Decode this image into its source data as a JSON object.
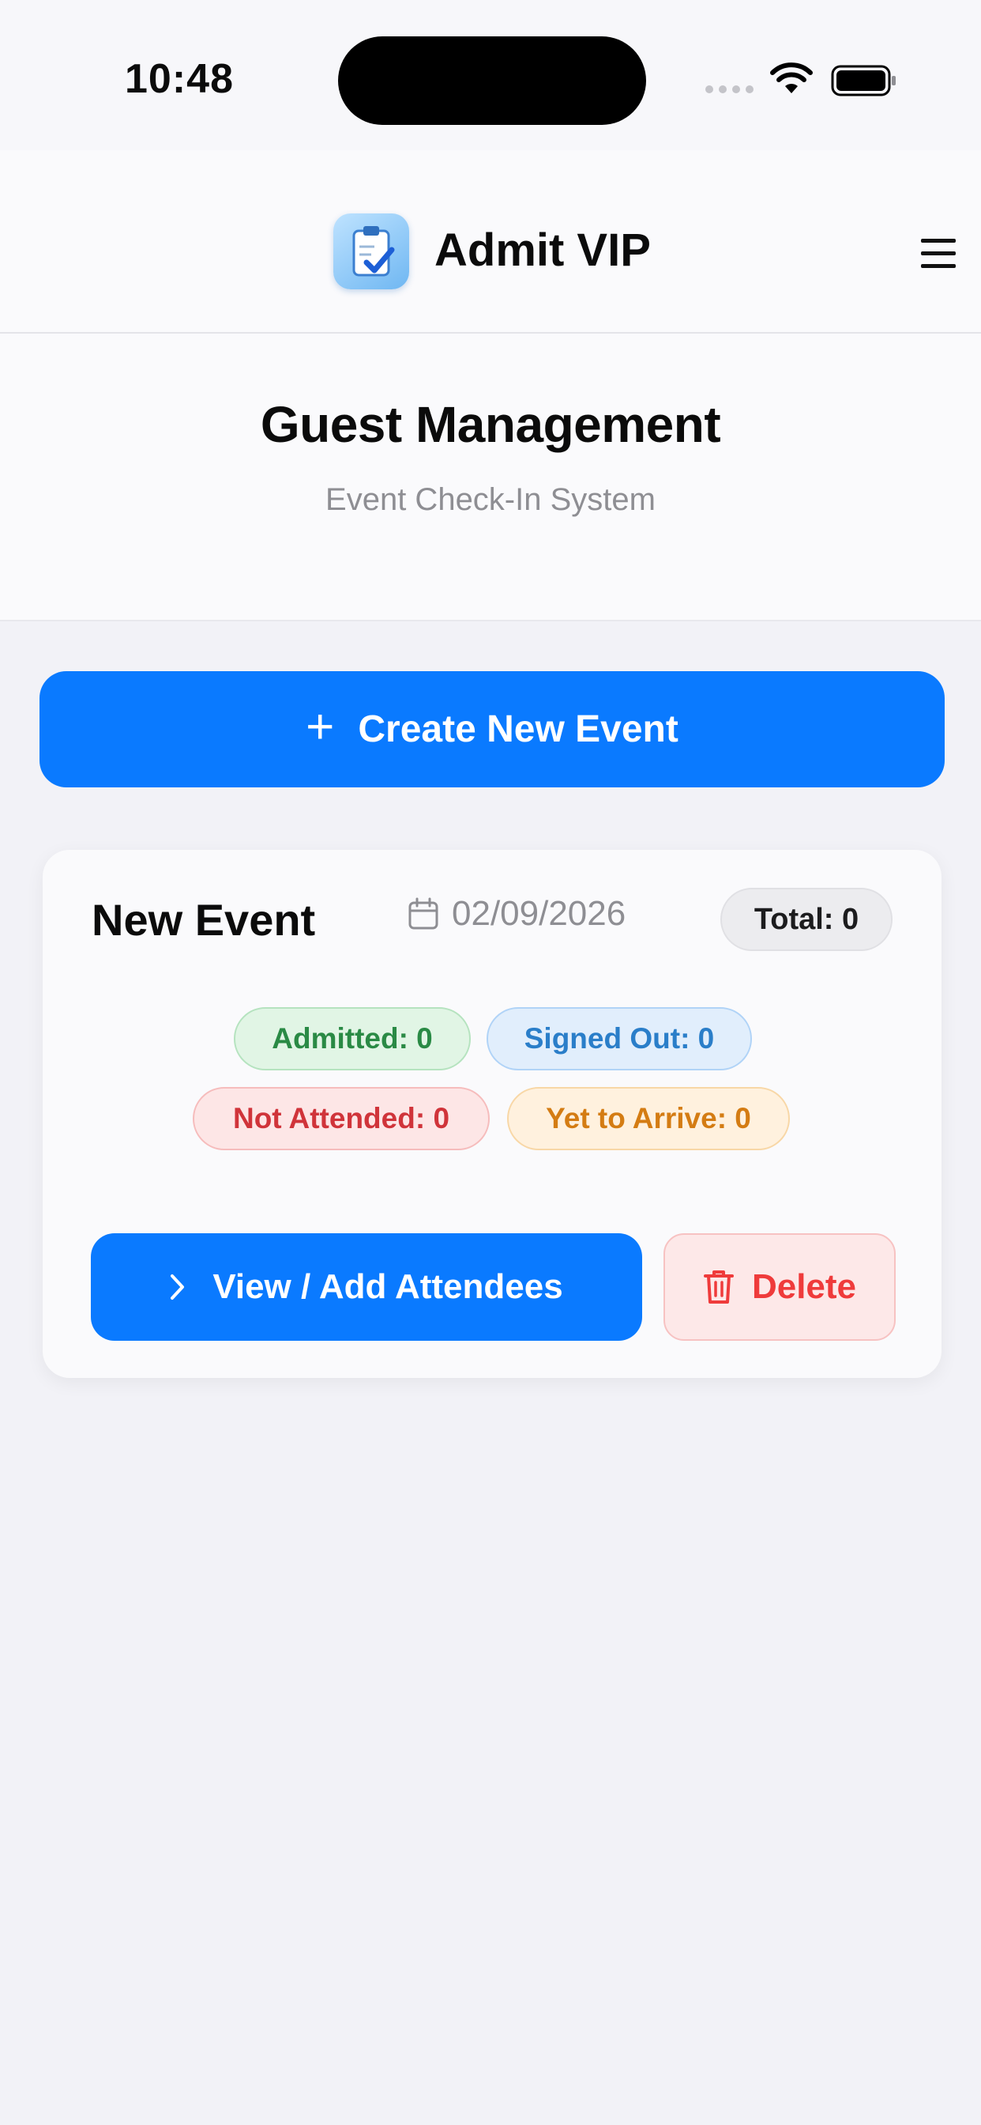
{
  "status_bar": {
    "time": "10:48"
  },
  "header": {
    "app_title": "Admit VIP",
    "logo_icon": "clipboard-check-icon",
    "menu_icon": "hamburger-menu-icon"
  },
  "hero": {
    "title": "Guest Management",
    "subtitle": "Event Check-In System"
  },
  "create_button": {
    "label": "Create New Event",
    "icon": "plus-icon"
  },
  "event": {
    "name": "New Event",
    "date": "02/09/2026",
    "total": "Total: 0",
    "stats": {
      "admitted": "Admitted: 0",
      "signed_out": "Signed Out: 0",
      "not_attended": "Not Attended: 0",
      "yet_to_arrive": "Yet to Arrive: 0"
    },
    "view_label": "View / Add Attendees",
    "delete_label": "Delete"
  },
  "colors": {
    "accent": "#0a7aff",
    "admitted": "#2a8a45",
    "signed_out": "#2a7ec9",
    "not_attended": "#d0343a",
    "yet_to_arrive": "#d47c13",
    "delete": "#ef3b3b"
  }
}
